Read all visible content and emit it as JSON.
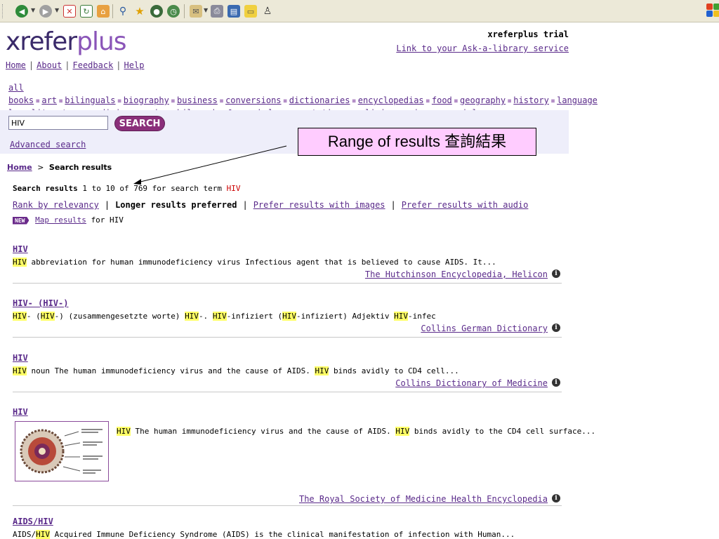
{
  "toolbar": {
    "icons": [
      "back-icon",
      "forward-icon",
      "stop-icon",
      "refresh-icon",
      "home-icon",
      "search-icon",
      "favorites-icon",
      "media-icon",
      "history-icon",
      "mail-icon",
      "print-icon",
      "edit-icon",
      "discuss-icon",
      "messenger-icon"
    ]
  },
  "header": {
    "logo_part1": "xrefer",
    "logo_part2": "plus",
    "trial_label": "xreferplus trial",
    "ask_link": "Link to your Ask-a-library service"
  },
  "topnav": [
    "Home",
    "About",
    "Feedback",
    "Help"
  ],
  "categories": [
    [
      "all books",
      "art",
      "bilinguals",
      "biography",
      "business",
      "conversions",
      "dictionaries",
      "encyclopedias",
      "food",
      "geography",
      "history",
      "language"
    ],
    [
      "law",
      "literature",
      "medicine",
      "music",
      "philosophy & psychology",
      "quotations",
      "religion",
      "science",
      "social sciences",
      "technology"
    ]
  ],
  "search": {
    "value": "HIV",
    "button_label": "SEARCH",
    "advanced_label": "Advanced search"
  },
  "callout": {
    "text": "Range of results 查詢結果"
  },
  "breadcrumb": {
    "home": "Home",
    "separator": ">",
    "current": "Search results"
  },
  "summary": {
    "label": "Search results",
    "range": "1 to 10 of 769 for search term",
    "term": "HIV"
  },
  "sort": {
    "relevancy": "Rank by relevancy",
    "longer": "Longer results preferred",
    "images": "Prefer results with images",
    "audio": "Prefer results with audio"
  },
  "map": {
    "badge": "NEW",
    "link": "Map results",
    "suffix": "for HIV"
  },
  "results": [
    {
      "title": "HIV",
      "snippet_parts": [
        [
          "HIV",
          true
        ],
        [
          " abbreviation for human immunodeficiency virus Infectious agent that is believed to cause AIDS. It...",
          false
        ]
      ],
      "source": "The Hutchinson Encyclopedia, Helicon"
    },
    {
      "title": "HIV- (HIV-)",
      "snippet_parts": [
        [
          "HIV",
          true
        ],
        [
          "- (",
          false
        ],
        [
          "HIV",
          true
        ],
        [
          "-) (zusammengesetzte worte) ",
          false
        ],
        [
          "HIV",
          true
        ],
        [
          "-. ",
          false
        ],
        [
          "HIV",
          true
        ],
        [
          "-infiziert (",
          false
        ],
        [
          "HIV",
          true
        ],
        [
          "-infiziert) Adjektiv ",
          false
        ],
        [
          "HIV",
          true
        ],
        [
          "-infec",
          false
        ]
      ],
      "source": "Collins German Dictionary"
    },
    {
      "title": "HIV",
      "snippet_parts": [
        [
          "HIV",
          true
        ],
        [
          " noun The human immunodeficiency virus and the cause of AIDS. ",
          false
        ],
        [
          "HIV",
          true
        ],
        [
          " binds avidly to CD4 cell...",
          false
        ]
      ],
      "source": "Collins Dictionary of Medicine"
    },
    {
      "title": "HIV",
      "snippet_parts": [
        [
          "HIV",
          true
        ],
        [
          " The human immunodeficiency virus and the cause of AIDS. ",
          false
        ],
        [
          "HIV",
          true
        ],
        [
          " binds avidly to the CD4 cell surface...",
          false
        ]
      ],
      "source": "The Royal Society of Medicine Health Encyclopedia"
    },
    {
      "title": "AIDS/HIV",
      "snippet_parts": [
        [
          "AIDS/",
          false
        ],
        [
          "HIV",
          true
        ],
        [
          " Acquired Immune Deficiency Syndrome (AIDS) is the clinical manifestation of infection with Human...",
          false
        ]
      ],
      "source": ""
    }
  ],
  "colors": {
    "link": "#5a2a8a",
    "highlight": "#ffff66",
    "search_button": "#8a2f7a",
    "callout_bg": "#ffccff",
    "search_panel": "#eeeefa"
  }
}
